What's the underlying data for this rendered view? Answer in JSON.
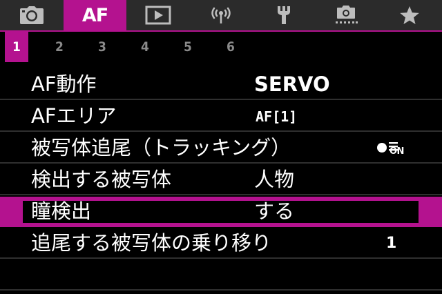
{
  "colors": {
    "accent": "#b4128f",
    "tab_bar_bg": "#2b2b2b",
    "background": "#000000",
    "inactive_subtab_text": "#8a8a8a"
  },
  "category_tabs": [
    {
      "id": "shooting",
      "icon": "camera-icon",
      "active": false
    },
    {
      "id": "af",
      "label": "AF",
      "active": true
    },
    {
      "id": "playback",
      "icon": "playback-icon",
      "active": false
    },
    {
      "id": "wireless",
      "icon": "wireless-icon",
      "active": false
    },
    {
      "id": "setup",
      "icon": "wrench-icon",
      "active": false
    },
    {
      "id": "custom",
      "icon": "custom-functions-icon",
      "active": false
    },
    {
      "id": "my_menu",
      "icon": "star-icon",
      "active": false
    }
  ],
  "sub_tabs": [
    "1",
    "2",
    "3",
    "4",
    "5",
    "6"
  ],
  "active_sub_tab": "1",
  "menu_items": [
    {
      "label": "AF動作",
      "value": "SERVO"
    },
    {
      "label": "AFエリア",
      "value": "AF[1]"
    },
    {
      "label": "被写体追尾（トラッキング）",
      "value_icon": "tracking-on-icon",
      "value_text": "ON"
    },
    {
      "label": "検出する被写体",
      "value": "人物"
    },
    {
      "label": "瞳検出",
      "value": "する",
      "selected": true
    },
    {
      "label": "追尾する被写体の乗り移り",
      "value": "1"
    }
  ]
}
